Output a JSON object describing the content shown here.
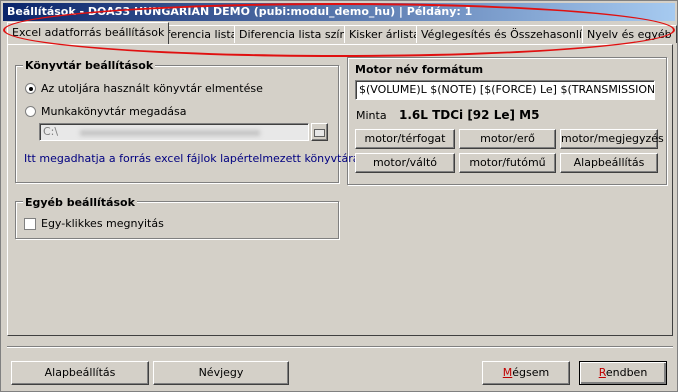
{
  "window": {
    "title": "Beállítások - DOAS3 HUNGARIAN DEMO (pubi:modul_demo_hu) | Példány: 1"
  },
  "tabs": [
    {
      "label": "Excel adatforrás beállítások",
      "active": true
    },
    {
      "label": "Diferencia lista"
    },
    {
      "label": "Diferencia lista színei"
    },
    {
      "label": "Kisker árlista"
    },
    {
      "label": "Véglegesítés és Összehasonlítás"
    },
    {
      "label": "Nyelv és egyéb"
    }
  ],
  "library": {
    "title": "Könyvtár beállítások",
    "radio_last": "Az utoljára használt könyvtár elmentése",
    "radio_custom": "Munkakönyvtár megadása",
    "path_value": "C:\\",
    "hint": "Itt megadhatja a forrás excel fájlok lapértelmezett könyvtárát."
  },
  "other": {
    "title": "Egyéb beállítások",
    "single_click": "Egy-klikkes megnyitás"
  },
  "motor": {
    "title": "Motor név formátum",
    "format_value": "$(VOLUME)L $(NOTE) [$(FORCE) Le] $(TRANSMISSION)",
    "sample_label": "Minta",
    "sample_value": "1.6L TDCi [92 Le] M5",
    "buttons": [
      "motor/térfogat",
      "motor/erő",
      "motor/megjegyzés",
      "motor/váltó",
      "motor/futómű",
      "Alapbeállítás"
    ]
  },
  "footer": {
    "defaults": "Alapbeállítás",
    "about": "Névjegy",
    "cancel_pre": "",
    "cancel_key": "M",
    "cancel_post": "égsem",
    "ok_pre": "",
    "ok_key": "R",
    "ok_post": "endben"
  },
  "colors": {
    "title_start": "#0a246a",
    "title_end": "#a6caf0",
    "highlight": "#e01010",
    "hint": "#000080",
    "accent_key": "#c00000"
  }
}
